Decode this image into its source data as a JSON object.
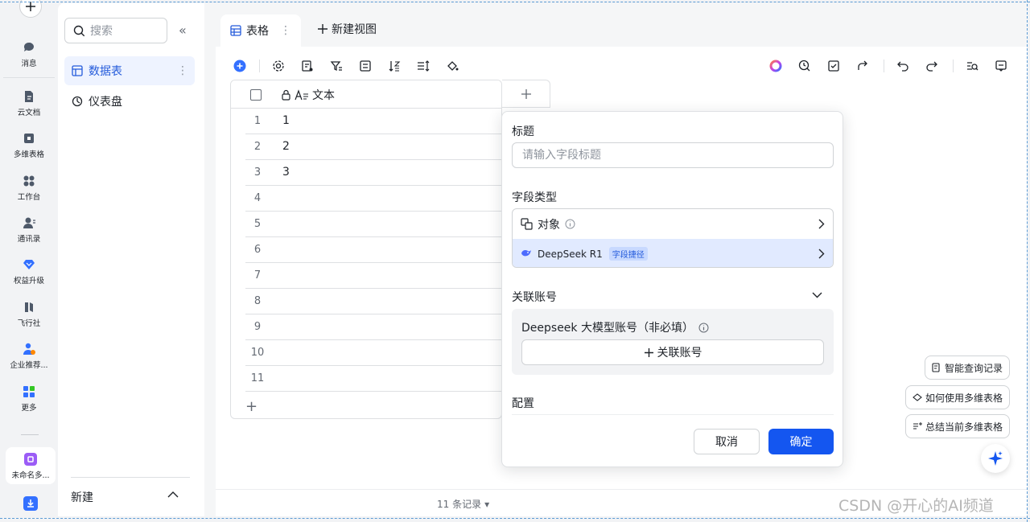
{
  "rail": {
    "items": [
      {
        "label": "消息",
        "icon": "message-icon"
      },
      {
        "label": "云文档",
        "icon": "cloud-doc-icon"
      },
      {
        "label": "多维表格",
        "icon": "base-icon"
      },
      {
        "label": "工作台",
        "icon": "workplace-icon"
      },
      {
        "label": "通讯录",
        "icon": "contacts-icon"
      },
      {
        "label": "权益升级",
        "icon": "upgrade-icon"
      },
      {
        "label": "飞行社",
        "icon": "club-icon"
      },
      {
        "label": "企业推荐...",
        "icon": "recommend-icon"
      },
      {
        "label": "更多",
        "icon": "more-apps-icon"
      }
    ],
    "open_app_label": "未命名多..."
  },
  "nav": {
    "search_placeholder": "搜索",
    "items": [
      {
        "label": "数据表",
        "icon": "table-icon",
        "active": true
      },
      {
        "label": "仪表盘",
        "icon": "dashboard-icon",
        "active": false
      }
    ],
    "new_label": "新建"
  },
  "tabs": {
    "active_label": "表格",
    "new_view_label": "新建视图"
  },
  "grid": {
    "column_header": "文本",
    "rows": [
      {
        "num": "1",
        "value": "1"
      },
      {
        "num": "2",
        "value": "2"
      },
      {
        "num": "3",
        "value": "3"
      },
      {
        "num": "4",
        "value": ""
      },
      {
        "num": "5",
        "value": ""
      },
      {
        "num": "6",
        "value": ""
      },
      {
        "num": "7",
        "value": ""
      },
      {
        "num": "8",
        "value": ""
      },
      {
        "num": "9",
        "value": ""
      },
      {
        "num": "10",
        "value": ""
      },
      {
        "num": "11",
        "value": ""
      }
    ],
    "record_count": "11 条记录"
  },
  "field_popover": {
    "title_label": "标题",
    "title_placeholder": "请输入字段标题",
    "type_label": "字段类型",
    "type_options": [
      {
        "label": "对象",
        "icon": "object-icon"
      },
      {
        "label": "DeepSeek R1",
        "tag": "字段捷径",
        "icon": "deepseek-icon",
        "selected": true
      }
    ],
    "account_label": "关联账号",
    "account_desc": "Deepseek 大模型账号（非必填）",
    "account_button": "关联账号",
    "config_label": "配置",
    "cancel": "取消",
    "confirm": "确定"
  },
  "ai_chips": [
    {
      "label": "智能查询记录",
      "icon": "query-record-icon"
    },
    {
      "label": "如何使用多维表格",
      "icon": "help-icon"
    },
    {
      "label": "总结当前多维表格",
      "icon": "summary-icon"
    }
  ],
  "watermark": "CSDN @开心的AI频道",
  "colors": {
    "accent": "#1456f0",
    "active_bg": "#eef3ff",
    "selected_type_bg": "#e1eaff"
  }
}
